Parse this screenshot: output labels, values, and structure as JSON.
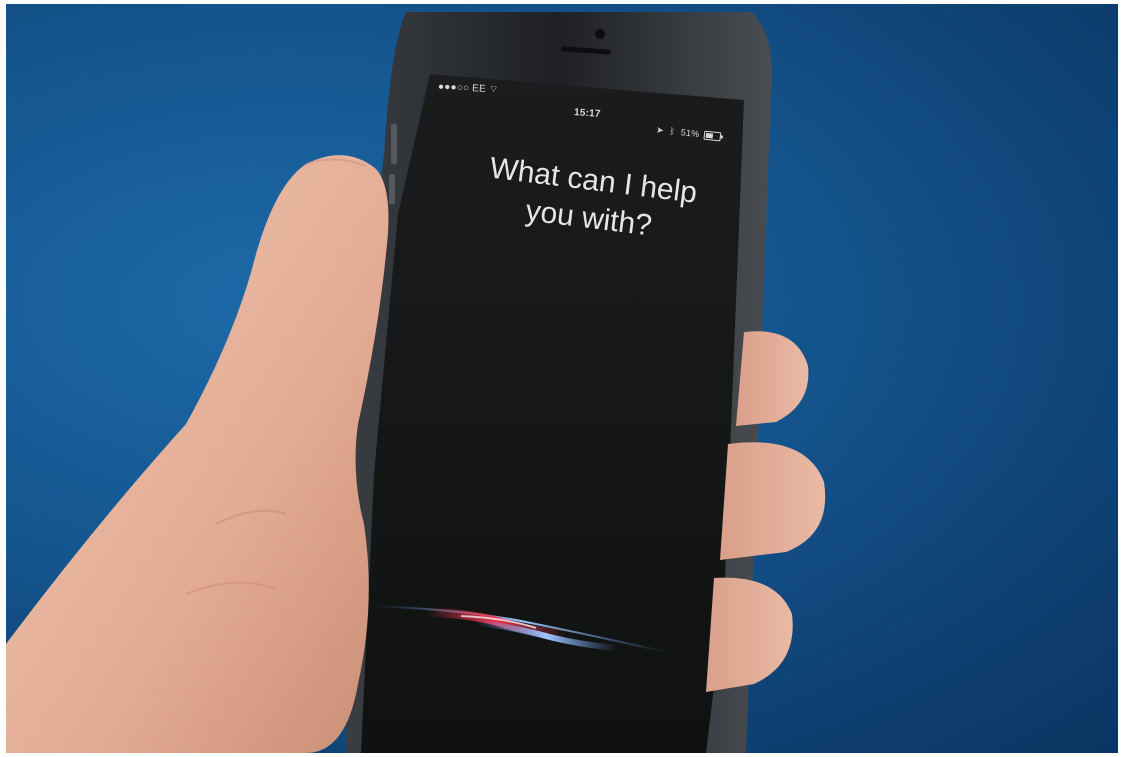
{
  "status_bar": {
    "signal_carrier": "●●●○○ EE",
    "time": "15:17",
    "battery_percent": "51%"
  },
  "siri": {
    "prompt_line_1": "What can I help",
    "prompt_line_2": "you with?"
  },
  "colors": {
    "background_blue": "#155791",
    "screen_black": "#161818",
    "siri_wave_red": "#e8334a",
    "siri_wave_blue": "#6fa8ff",
    "skin": "#e8b9a3"
  },
  "icons": [
    "wifi-icon",
    "location-icon",
    "bluetooth-icon",
    "battery-icon",
    "siri-waveform-icon"
  ]
}
